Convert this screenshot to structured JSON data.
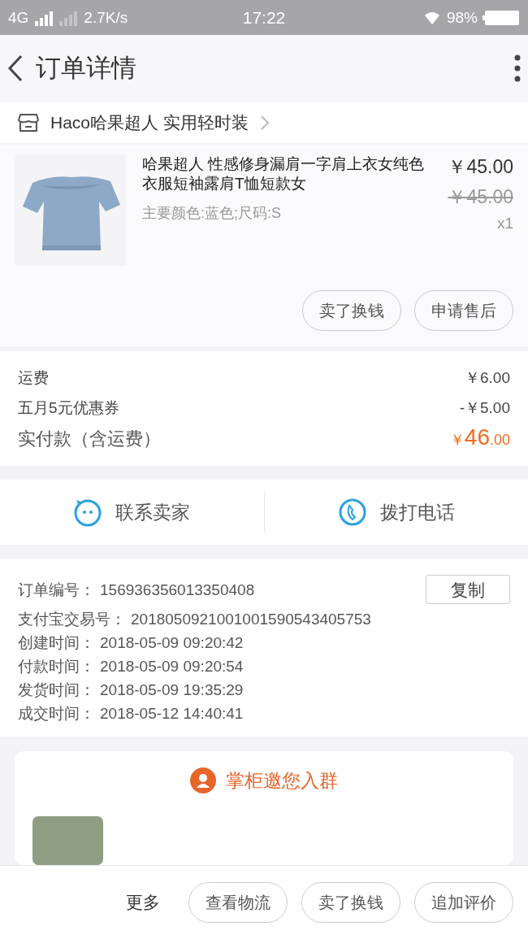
{
  "status_bar": {
    "network": "4G",
    "speed": "2.7K/s",
    "time": "17:22",
    "battery": "98%"
  },
  "header": {
    "title": "订单详情"
  },
  "shop": {
    "name": "Haco哈果超人 实用轻时装"
  },
  "product": {
    "title": "哈果超人 性感修身漏肩一字肩上衣女纯色衣服短袖露肩T恤短款女",
    "sku": "主要颜色:蓝色;尺码:S",
    "price": "￥45.00",
    "original_price": "￥45.00",
    "quantity": "x1",
    "actions": [
      "卖了换钱",
      "申请售后"
    ]
  },
  "fees": {
    "rows": [
      {
        "label": "运费",
        "value": "￥6.00"
      },
      {
        "label": "五月5元优惠券",
        "value": "-￥5.00"
      }
    ],
    "total": {
      "label": "实付款（含运费）",
      "currency": "￥",
      "integer": "46",
      "decimal": ".00"
    }
  },
  "contact": [
    {
      "kind": "chat",
      "label": "联系卖家"
    },
    {
      "kind": "phone",
      "label": "拨打电话"
    }
  ],
  "order_info": {
    "copy_button": "复制",
    "rows": [
      {
        "label": "订单编号：",
        "value": "156936356013350408"
      },
      {
        "label": "支付宝交易号：",
        "value": "2018050921001001590543405753"
      },
      {
        "label": "创建时间：",
        "value": "2018-05-09 09:20:42"
      },
      {
        "label": "付款时间：",
        "value": "2018-05-09 09:20:54"
      },
      {
        "label": "发货时间：",
        "value": "2018-05-09 19:35:29"
      },
      {
        "label": "成交时间：",
        "value": "2018-05-12 14:40:41"
      }
    ]
  },
  "group_card": {
    "title": "掌柜邀您入群"
  },
  "bottom_bar": {
    "more": "更多",
    "buttons": [
      "查看物流",
      "卖了换钱",
      "追加评价"
    ]
  }
}
